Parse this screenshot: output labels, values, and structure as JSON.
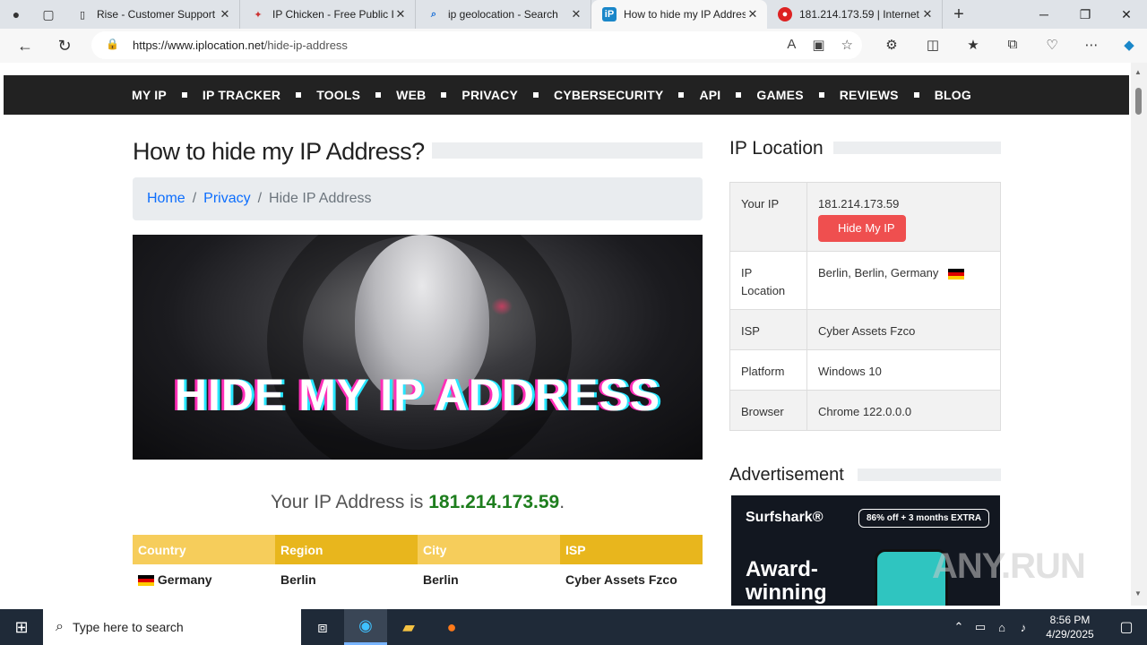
{
  "browser": {
    "tabs": [
      {
        "title": "Rise - Customer Support",
        "favicon": "doc"
      },
      {
        "title": "IP Chicken - Free Public IP",
        "favicon": "chicken"
      },
      {
        "title": "ip geolocation - Search",
        "favicon": "search"
      },
      {
        "title": "How to hide my IP Address",
        "favicon": "iP",
        "active": true
      },
      {
        "title": "181.214.173.59 | Internet",
        "favicon": "red"
      }
    ],
    "url": "https://www.iplocation.net/hide-ip-address",
    "url_host": "https://www.iplocation.net",
    "url_path": "/hide-ip-address"
  },
  "site": {
    "nav": [
      "MY IP",
      "IP TRACKER",
      "TOOLS",
      "WEB",
      "PRIVACY",
      "CYBERSECURITY",
      "API",
      "GAMES",
      "REVIEWS",
      "BLOG"
    ],
    "page_title": "How to hide my IP Address?",
    "breadcrumb": {
      "home": "Home",
      "privacy": "Privacy",
      "current": "Hide IP Address"
    },
    "hero_text": "HIDE MY IP ADDRESS",
    "your_ip_prefix": "Your IP Address is ",
    "your_ip": "181.214.173.59",
    "your_ip_suffix": ".",
    "table": {
      "headers": [
        "Country",
        "Region",
        "City",
        "ISP"
      ],
      "header_colors": [
        "#f6cd5b",
        "#e8b61d",
        "#f6cd5b",
        "#e8b61d"
      ],
      "row": [
        "Germany",
        "Berlin",
        "Berlin",
        "Cyber Assets Fzco"
      ]
    }
  },
  "sidebar": {
    "title": "IP Location",
    "rows": [
      {
        "key": "Your IP",
        "value": "181.214.173.59"
      },
      {
        "key": "IP Location",
        "value": "Berlin, Berlin, Germany"
      },
      {
        "key": "ISP",
        "value": "Cyber Assets Fzco"
      },
      {
        "key": "Platform",
        "value": "Windows 10"
      },
      {
        "key": "Browser",
        "value": "Chrome 122.0.0.0"
      }
    ],
    "hide_button": "Hide My IP",
    "ad_title": "Advertisement",
    "ad": {
      "brand": "Surfshark®",
      "promo": "86% off + 3 months EXTRA",
      "headline": "Award-\nwinning"
    }
  },
  "watermark": "ANY.RUN",
  "taskbar": {
    "search_placeholder": "Type here to search",
    "time": "8:56 PM",
    "date": "4/29/2025"
  }
}
